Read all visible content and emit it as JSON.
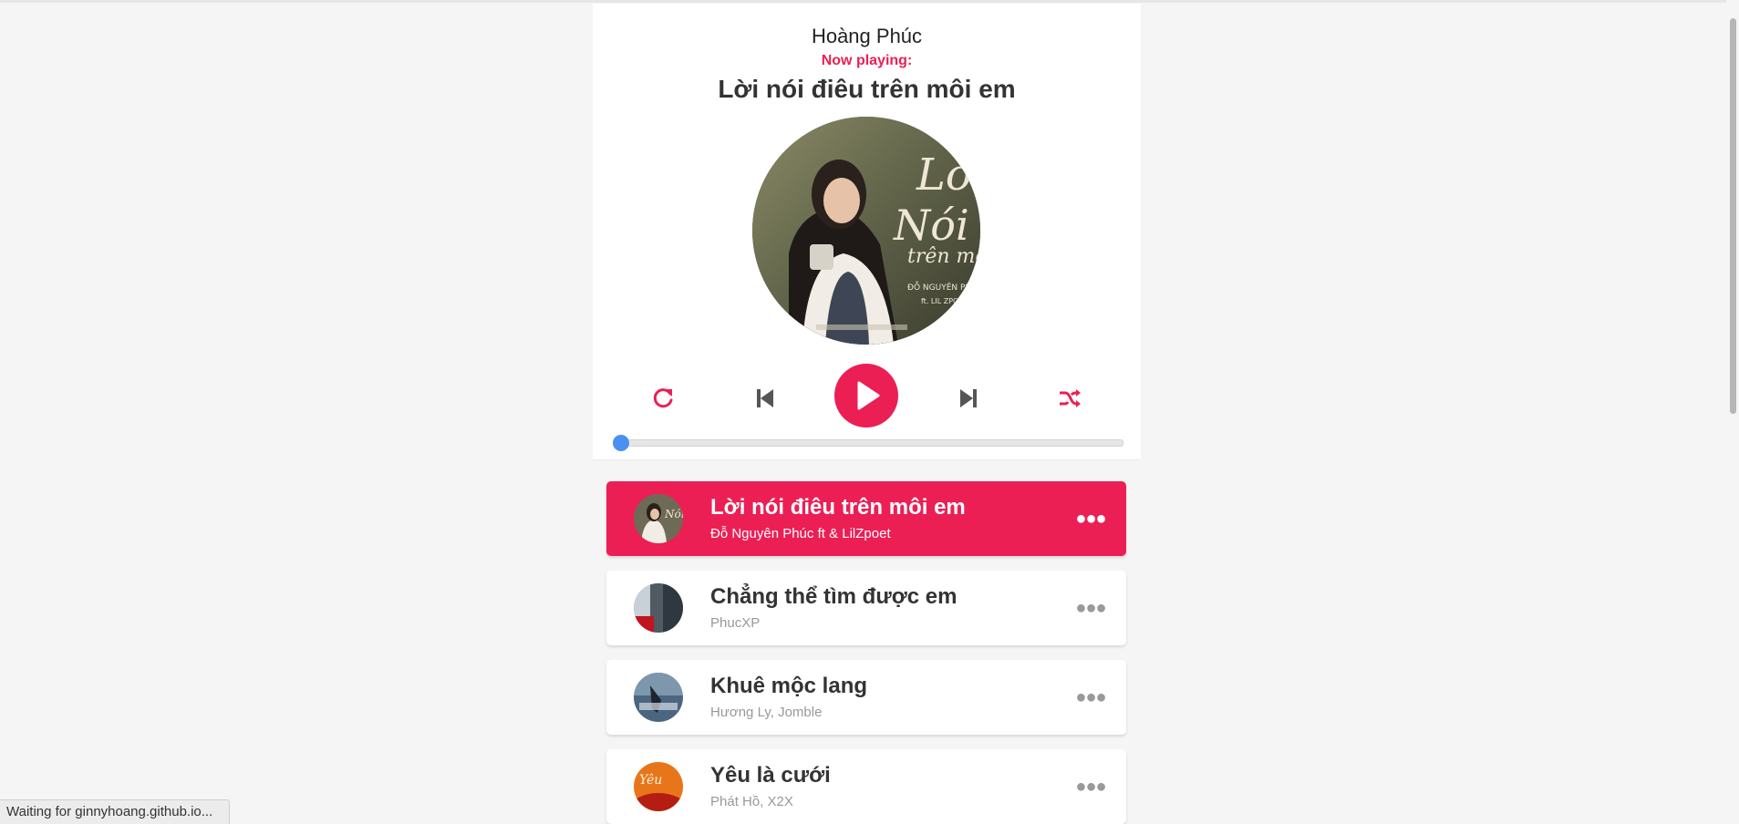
{
  "app": {
    "owner": "Hoàng Phúc",
    "now_playing_label": "Now playing:",
    "current_song": "Lời nói điêu trên môi em",
    "accent_color": "#ec1f55",
    "progress_percent": 0
  },
  "controls": {
    "repeat_icon": "repeat-icon",
    "prev_icon": "step-backward-icon",
    "play_icon": "play-icon",
    "next_icon": "step-forward-icon",
    "random_icon": "shuffle-icon"
  },
  "playlist": [
    {
      "name": "Lời nói điêu trên môi em",
      "author": "Đỗ Nguyên Phúc ft & LilZpoet",
      "active": true
    },
    {
      "name": "Chẳng thể tìm được em",
      "author": "PhucXP",
      "active": false
    },
    {
      "name": "Khuê mộc lang",
      "author": "Hương Ly, Jomble",
      "active": false
    },
    {
      "name": "Yêu là cưới",
      "author": "Phát Hồ, X2X",
      "active": false
    }
  ],
  "status_bar": {
    "text": "Waiting for ginnyhoang.github.io..."
  }
}
